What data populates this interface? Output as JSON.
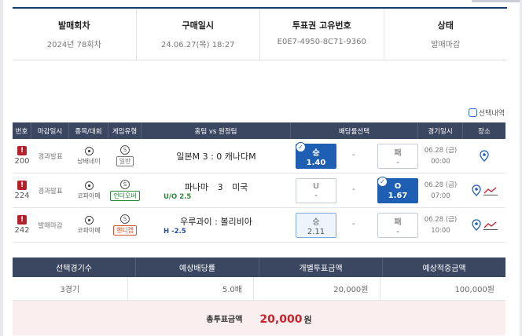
{
  "info": {
    "headers": [
      "발매회차",
      "구매일시",
      "투표권 고유번호",
      "상태"
    ],
    "values": [
      "2024년 78회차",
      "24.06.27(목) 18:27",
      "E0E7-4950-8C71-9360",
      "발매마감"
    ]
  },
  "history_label": "선택내역",
  "game_headers": [
    "번호",
    "마감일시",
    "종목/대회",
    "게임유형",
    "홈팀 vs 원정팀",
    "배당률선택",
    "경기일시",
    "장소"
  ],
  "rows": [
    {
      "num": "200",
      "close": "경과발표",
      "league": "남배네이",
      "sport_icon": "volleyball-icon",
      "gtype_badge": "S",
      "gtype": "일반",
      "gtype_color": "#777777",
      "home": "일본M",
      "score": "3 : 0",
      "away": "캐나다M",
      "subline": "",
      "odds": [
        {
          "label": "승",
          "value": "1.40",
          "state": "selected"
        },
        {
          "label": "-",
          "value": "",
          "state": "dash"
        },
        {
          "label": "패",
          "value": "-",
          "state": "normal"
        }
      ],
      "date": "06.28 (금)",
      "time": "00:00",
      "chart": false
    },
    {
      "num": "224",
      "close": "경과발표",
      "league": "코파아메",
      "sport_icon": "soccer-ball-icon",
      "gtype_badge": "S",
      "gtype": "언더오버",
      "gtype_color": "#2c8a3c",
      "home": "파나마",
      "score": "3",
      "away": "미국",
      "subline": "U/O 2.5",
      "odds": [
        {
          "label": "U",
          "value": "-",
          "state": "normal"
        },
        {
          "label": "-",
          "value": "",
          "state": "dash"
        },
        {
          "label": "O",
          "value": "1.67",
          "state": "selected"
        }
      ],
      "date": "06.28 (금)",
      "time": "07:00",
      "chart": true
    },
    {
      "num": "242",
      "close": "발매마감",
      "league": "코파아메",
      "sport_icon": "soccer-ball-icon",
      "gtype_badge": "S",
      "gtype": "핸디캡",
      "gtype_color": "#d4532b",
      "home": "우루과이",
      "score": ":",
      "away": "볼리비아",
      "subline": "H -2.5",
      "odds": [
        {
          "label": "승",
          "value": "2.11",
          "state": "light"
        },
        {
          "label": "-",
          "value": "",
          "state": "dash"
        },
        {
          "label": "패",
          "value": "-",
          "state": "normal"
        }
      ],
      "date": "06.28 (금)",
      "time": "10:00",
      "chart": true
    }
  ],
  "summary": {
    "headers": [
      "선택경기수",
      "예상배당률",
      "개별투표금액",
      "예상적중금액"
    ],
    "values": [
      "3경기",
      "5.0배",
      "20,000원",
      "100,000원"
    ]
  },
  "total": {
    "label": "총투표금액",
    "value": "20,000",
    "unit": "원"
  },
  "colors": {
    "header_bg": "#3b4760",
    "accent": "#1e5fb3",
    "total_bg": "#fbeeee",
    "total_value": "#c8222c"
  }
}
